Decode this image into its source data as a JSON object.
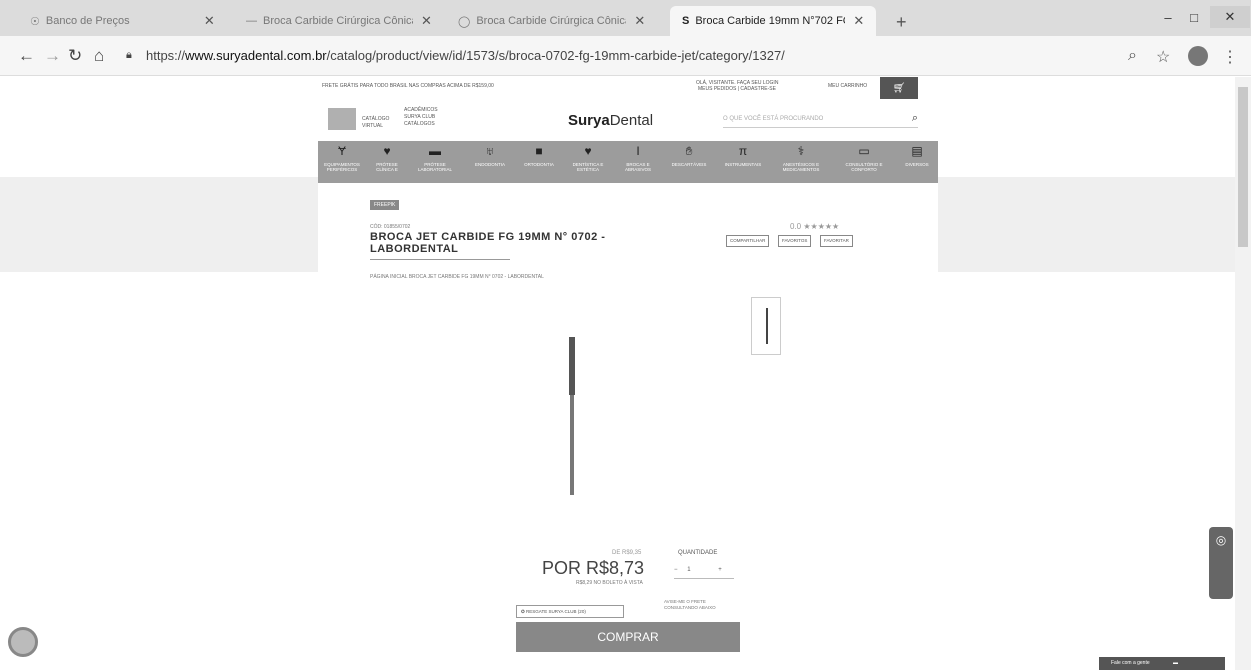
{
  "tabs": [
    {
      "title": "Banco de Preços",
      "icon": "globe-icon"
    },
    {
      "title": "Broca Carbide Cirúrgica Cônica",
      "icon": "page-icon"
    },
    {
      "title": "Broca Carbide Cirúrgica Cônica",
      "icon": "search-icon"
    },
    {
      "title": "Broca Carbide 19mm N°702 FG",
      "icon": "site-icon"
    }
  ],
  "address": {
    "prefix": "https://",
    "host": "www.suryadental.com.br",
    "path": "/catalog/product/view/id/1573/s/broca-0702-fg-19mm-carbide-jet/category/1327/"
  },
  "site": {
    "topbar": {
      "left": "FRETE GRÁTIS PARA TODO BRASIL NAS COMPRAS ACIMA DE R$159,00",
      "middle1": "OLÁ, VISITANTE. FAÇA SEU LOGIN",
      "middle2": "MEUS PEDIDOS | CADASTRE-SE",
      "account": "MEU CARRINHO"
    },
    "header": {
      "cat1": "CATÁLOGO",
      "cat2": "VIRTUAL",
      "opt1": "ACADÊMICOS",
      "opt2": "SURYA CLUB",
      "opt3": "CATÁLOGOS",
      "logo_bold": "Surya",
      "logo_rest": "Dental",
      "search_placeholder": "O QUE VOCÊ ESTÁ PROCURANDO"
    },
    "menu": [
      {
        "label": "EQUIPAMENTOS PERIFÉRICOS",
        "icon": "chair-icon"
      },
      {
        "label": "PRÓTESE CLÍNICA E",
        "icon": "tooth-icon"
      },
      {
        "label": "PRÓTESE LABORATORIAL",
        "icon": "lab-icon"
      },
      {
        "label": "ENDODONTIA",
        "icon": "tooth-root-icon"
      },
      {
        "label": "ORTODONTIA",
        "icon": "braces-icon"
      },
      {
        "label": "DENTÍSTICA E ESTÉTICA",
        "icon": "tooth-icon"
      },
      {
        "label": "BROCAS E ABRASIVOS",
        "icon": "bur-icon"
      },
      {
        "label": "DESCARTÁVEIS",
        "icon": "glove-icon"
      },
      {
        "label": "INSTRUMENTAIS",
        "icon": "instrument-icon"
      },
      {
        "label": "ANESTÉSICOS E MEDICAMENTOS",
        "icon": "syringe-icon"
      },
      {
        "label": "CONSULTÓRIO E CONFORTO",
        "icon": "kit-icon"
      },
      {
        "label": "DIVERSOS",
        "icon": "box-icon"
      }
    ],
    "product": {
      "badge": "FREEPIK",
      "sku": "CÓD: 01855/0702",
      "title": "BROCA JET CARBIDE FG 19MM N° 0702 - LABORDENTAL",
      "rating_label": "0.0",
      "btn_compare": "COMPARTILHAR",
      "btn_wish": "FAVORITOS",
      "btn_fav": "FAVORITAR",
      "breadcrumb": "PÁGINA INICIAL  BROCA JET CARBIDE FG 19MM N° 0702 - LABORDENTAL",
      "was_price": "DE R$9,35",
      "qty_label": "QUANTIDADE",
      "price": "POR R$8,73",
      "qty_value": "1",
      "boleto": "R$8,29 NO BOLETO À VISTA",
      "surya_club": "RESGATE SURYA CLUB (20)",
      "note": "AVISE-ME O FRETE CONSULTANDO ABAIXO",
      "buy": "COMPRAR"
    },
    "chat": "Fale com a gente"
  }
}
